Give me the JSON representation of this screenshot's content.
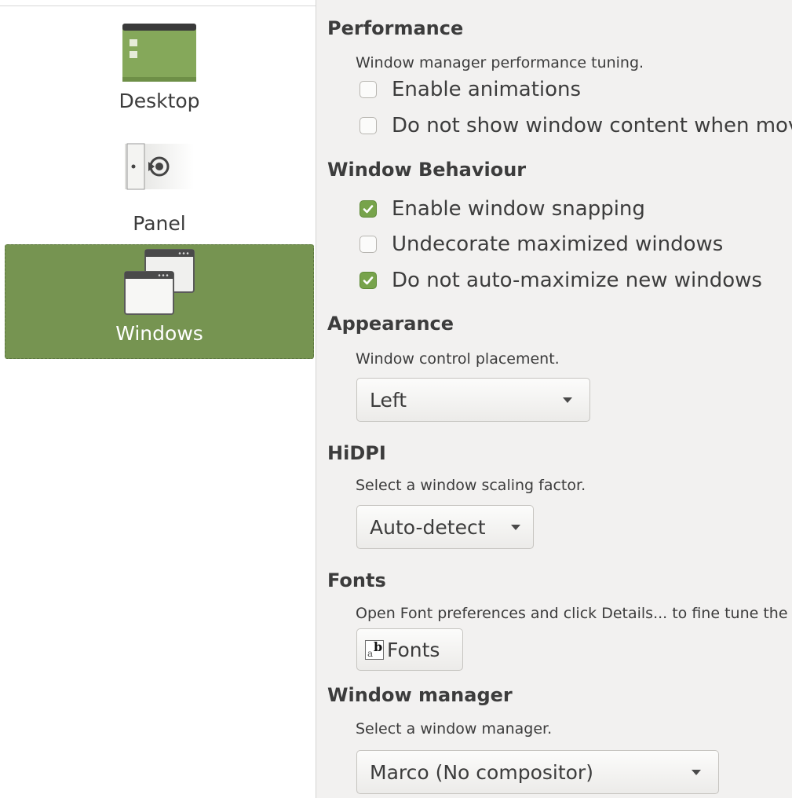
{
  "sidebar": {
    "items": [
      {
        "label": "Desktop",
        "icon": "desktop-icon",
        "selected": false
      },
      {
        "label": "Panel",
        "icon": "panel-icon",
        "selected": false
      },
      {
        "label": "Windows",
        "icon": "windows-icon",
        "selected": true
      }
    ]
  },
  "performance": {
    "title": "Performance",
    "description": "Window manager performance tuning.",
    "options": [
      {
        "label": "Enable animations",
        "checked": false
      },
      {
        "label": "Do not show window content when moving windows",
        "checked": false
      }
    ]
  },
  "behaviour": {
    "title": "Window Behaviour",
    "options": [
      {
        "label": "Enable window snapping",
        "checked": true
      },
      {
        "label": "Undecorate maximized windows",
        "checked": false
      },
      {
        "label": "Do not auto-maximize new windows",
        "checked": true
      }
    ]
  },
  "appearance": {
    "title": "Appearance",
    "description": "Window control placement.",
    "selected": "Left"
  },
  "hidpi": {
    "title": "HiDPI",
    "description": "Select a window scaling factor.",
    "selected": "Auto-detect"
  },
  "fonts": {
    "title": "Fonts",
    "description": "Open Font preferences and click Details... to fine tune the font rendering.",
    "button_label": "Fonts"
  },
  "wm": {
    "title": "Window manager",
    "description": "Select a window manager.",
    "selected": "Marco (No compositor)"
  },
  "colors": {
    "accent": "#769451",
    "check": "#77a34b",
    "content_bg": "#f2f1f0"
  }
}
